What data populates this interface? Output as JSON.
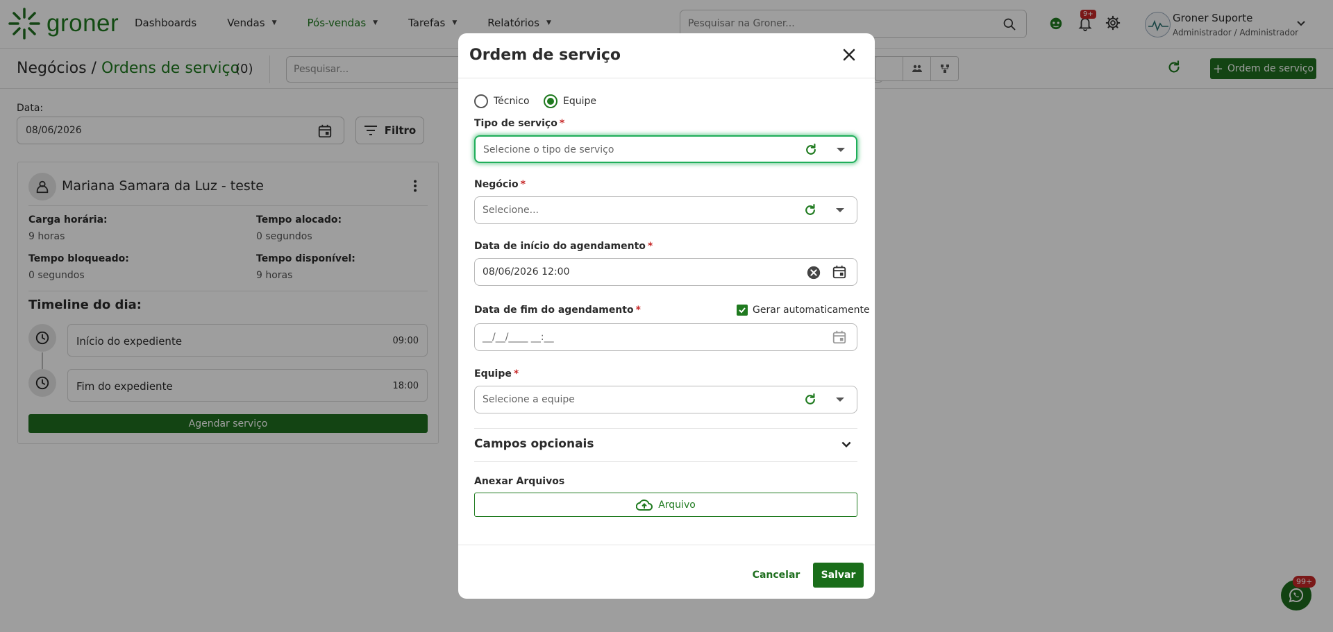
{
  "navbar": {
    "logo_text": "groner",
    "menu": [
      {
        "label": "Dashboards",
        "has_caret": false,
        "active": false
      },
      {
        "label": "Vendas",
        "has_caret": true,
        "active": false
      },
      {
        "label": "Pós-vendas",
        "has_caret": true,
        "active": true
      },
      {
        "label": "Tarefas",
        "has_caret": true,
        "active": false
      },
      {
        "label": "Relatórios",
        "has_caret": true,
        "active": false
      }
    ],
    "search_placeholder": "Pesquisar na Groner...",
    "notification_badge": "9+",
    "user_name": "Groner Suporte",
    "user_role": "Administrador / Administrador"
  },
  "subheader": {
    "title_prefix": "Negócios / ",
    "title_current": "Ordens de serviço",
    "count": "(0)",
    "search_placeholder": "Pesquisar...",
    "new_button_label": "Ordem de serviço"
  },
  "filters": {
    "date_label": "Data:",
    "date_value": "08/06/2026",
    "filter_label": "Filtro"
  },
  "tech_card": {
    "name": "Mariana Samara da Luz - teste",
    "stats": {
      "carga_label": "Carga horária:",
      "carga_value": "9 horas",
      "alocado_label": "Tempo alocado:",
      "alocado_value": "0 segundos",
      "bloqueado_label": "Tempo bloqueado:",
      "bloqueado_value": "0 segundos",
      "disponivel_label": "Tempo disponível:",
      "disponivel_value": "9 horas"
    },
    "timeline_title": "Timeline do dia:",
    "timeline": [
      {
        "label": "Início do expediente",
        "time": "09:00"
      },
      {
        "label": "Fim do expediente",
        "time": "18:00"
      }
    ],
    "schedule_button": "Agendar serviço"
  },
  "modal": {
    "title": "Ordem de serviço",
    "radio_tecnico": "Técnico",
    "radio_equipe": "Equipe",
    "selected_radio": "Equipe",
    "tipo_label": "Tipo de serviço",
    "tipo_placeholder": "Selecione o tipo de serviço",
    "negocio_label": "Negócio",
    "negocio_placeholder": "Selecione...",
    "inicio_label": "Data de início do agendamento",
    "inicio_value": "08/06/2026 12:00",
    "fim_label": "Data de fim do agendamento",
    "fim_placeholder": "__/__/____ __:__",
    "auto_generate_label": "Gerar automaticamente",
    "equipe_label": "Equipe",
    "equipe_placeholder": "Selecione a equipe",
    "optional_title": "Campos opcionais",
    "attach_label": "Anexar Arquivos",
    "attach_button": "Arquivo",
    "cancel_button": "Cancelar",
    "save_button": "Salvar"
  },
  "whatsapp_badge": "99+",
  "colors": {
    "brand_green": "#1f7a1f",
    "button_green": "#1f6f1f",
    "focus_green": "#1fae5a",
    "required_red": "#c62828"
  }
}
